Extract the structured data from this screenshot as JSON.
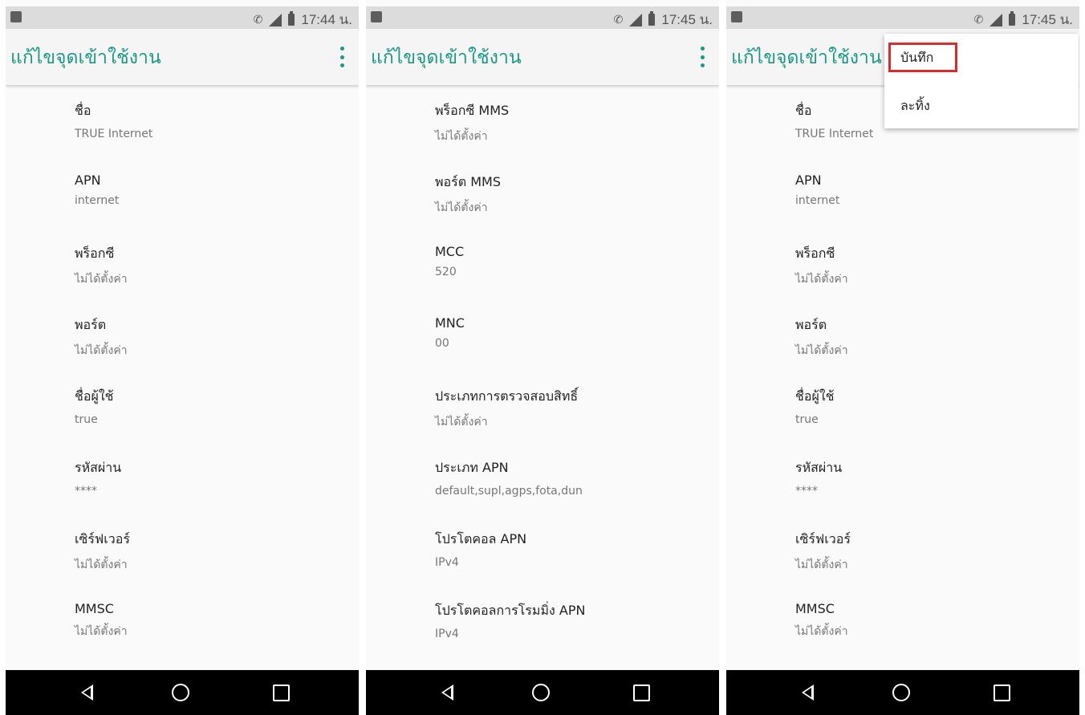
{
  "toolbar": {
    "title": "แก้ไขจุดเข้าใช้งาน"
  },
  "screen1": {
    "time": "17:44 น.",
    "items": [
      {
        "title": "ชื่อ",
        "value": "TRUE Internet"
      },
      {
        "title": "APN",
        "value": "internet"
      },
      {
        "title": "พร็อกซี",
        "value": "ไม่ได้ตั้งค่า"
      },
      {
        "title": "พอร์ต",
        "value": "ไม่ได้ตั้งค่า"
      },
      {
        "title": "ชื่อผู้ใช้",
        "value": "true"
      },
      {
        "title": "รหัสผ่าน",
        "value": "****"
      },
      {
        "title": "เซิร์ฟเวอร์",
        "value": "ไม่ได้ตั้งค่า"
      },
      {
        "title": "MMSC",
        "value": "ไม่ได้ตั้งค่า"
      }
    ]
  },
  "screen2": {
    "time": "17:45 น.",
    "items": [
      {
        "title": "พร็อกซี MMS",
        "value": "ไม่ได้ตั้งค่า"
      },
      {
        "title": "พอร์ต MMS",
        "value": "ไม่ได้ตั้งค่า"
      },
      {
        "title": "MCC",
        "value": "520"
      },
      {
        "title": "MNC",
        "value": "00"
      },
      {
        "title": "ประเภทการตรวจสอบสิทธิ์",
        "value": "ไม่ได้ตั้งค่า"
      },
      {
        "title": "ประเภท APN",
        "value": "default,supl,agps,fota,dun"
      },
      {
        "title": "โปรโตคอล APN",
        "value": "IPv4"
      },
      {
        "title": "โปรโตคอลการโรมมิ่ง APN",
        "value": "IPv4"
      }
    ]
  },
  "screen3": {
    "time": "17:45 น.",
    "items": [
      {
        "title": "ชื่อ",
        "value": "TRUE Internet"
      },
      {
        "title": "APN",
        "value": "internet"
      },
      {
        "title": "พร็อกซี",
        "value": "ไม่ได้ตั้งค่า"
      },
      {
        "title": "พอร์ต",
        "value": "ไม่ได้ตั้งค่า"
      },
      {
        "title": "ชื่อผู้ใช้",
        "value": "true"
      },
      {
        "title": "รหัสผ่าน",
        "value": "****"
      },
      {
        "title": "เซิร์ฟเวอร์",
        "value": "ไม่ได้ตั้งค่า"
      },
      {
        "title": "MMSC",
        "value": "ไม่ได้ตั้งค่า"
      }
    ],
    "menu": {
      "save": "บันทึก",
      "discard": "ละทิ้ง"
    }
  },
  "colors": {
    "accent": "#1a9a86",
    "highlight": "#d92b2b",
    "navbar": "#000000"
  },
  "icons": {
    "status": [
      "image-icon",
      "call-icon",
      "signal-icon",
      "battery-icon"
    ],
    "nav": [
      "back-icon",
      "home-icon",
      "recents-icon"
    ]
  }
}
